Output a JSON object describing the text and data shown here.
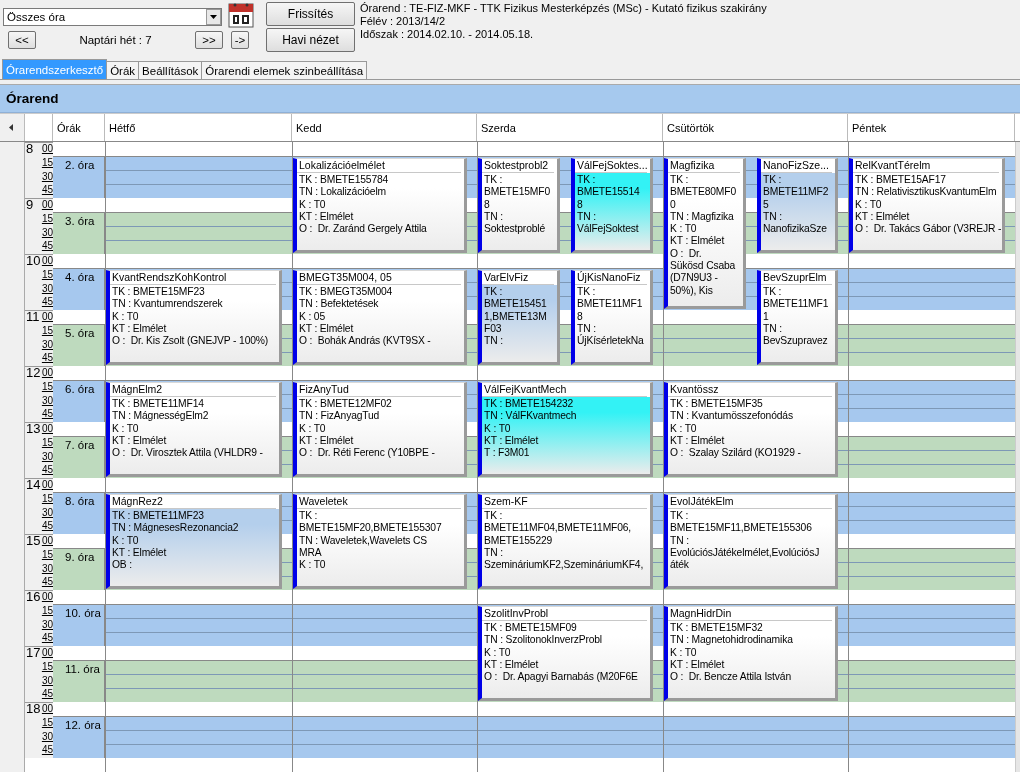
{
  "toolbar": {
    "view_select": {
      "value": "Összes óra"
    },
    "prev_button": "<<",
    "week_label": "Naptári hét : 7",
    "next_button": ">>",
    "go_button": "->",
    "refresh_button": "Frissítés",
    "month_button": "Havi nézet"
  },
  "info": [
    "Órarend : TE-FIZ-MKF - TTK Fizikus Mesterképzés (MSc) - Kutató fizikus szakirány",
    "Félév : 2013/14/2",
    "Időszak : 2014.02.10. - 2014.05.18."
  ],
  "tabs": [
    {
      "label": "Órarendszerkesztő",
      "selected": true
    },
    {
      "label": "Órák",
      "selected": false
    },
    {
      "label": "Beállítások",
      "selected": false
    },
    {
      "label": "Órarendi elemek szinbeállítása",
      "selected": false
    }
  ],
  "panel_title": "Órarend",
  "periods_header": "Órák",
  "days": [
    "Hétfő",
    "Kedd",
    "Szerda",
    "Csütörtök",
    "Péntek"
  ],
  "hours": [
    {
      "hour": "8",
      "minutes": [
        "00",
        "15",
        "30",
        "45"
      ]
    },
    {
      "hour": "9",
      "minutes": [
        "00",
        "15",
        "30",
        "45"
      ]
    },
    {
      "hour": "10",
      "minutes": [
        "00",
        "15",
        "30",
        "45"
      ]
    },
    {
      "hour": "11",
      "minutes": [
        "00",
        "15",
        "30",
        "45"
      ]
    },
    {
      "hour": "12",
      "minutes": [
        "00",
        "15",
        "30",
        "45"
      ]
    },
    {
      "hour": "13",
      "minutes": [
        "00",
        "15",
        "30",
        "45"
      ]
    },
    {
      "hour": "14",
      "minutes": [
        "00",
        "15",
        "30",
        "45"
      ]
    },
    {
      "hour": "15",
      "minutes": [
        "00",
        "15",
        "30",
        "45"
      ]
    },
    {
      "hour": "16",
      "minutes": [
        "00",
        "15",
        "30",
        "45"
      ]
    },
    {
      "hour": "17",
      "minutes": [
        "00",
        "15",
        "30",
        "45"
      ]
    },
    {
      "hour": "18",
      "minutes": [
        "00",
        "15",
        "30",
        "45"
      ]
    }
  ],
  "periods": [
    {
      "label": "2. óra",
      "color": "#a6c8ee",
      "cells": [
        {},
        {
          "events": [
            {
              "kind": "full",
              "title": "Lokalizációelmélet",
              "color": "#ffffff",
              "lines": [
                "TK : BMETE155784",
                "TN : Lokalizációelm",
                "K : T0",
                "KT : Elmélet",
                "O :  Dr. Zaránd Gergely Attila"
              ]
            }
          ]
        },
        {
          "events": [
            {
              "kind": "left",
              "title": "Soktestprobl2",
              "color": "#ffffff",
              "lines": [
                "TK :",
                "BMETE15MF0",
                "8",
                "TN :",
                "Soktestproblé"
              ]
            },
            {
              "kind": "right",
              "title": "VálFejSoktes...",
              "color": "#33f2f5",
              "lines": [
                "TK :",
                "BMETE15514",
                "8",
                "TN :",
                "VálFejSoktest"
              ]
            }
          ]
        },
        {
          "events": [
            {
              "kind": "tallleft",
              "title": "Magfizika",
              "color": "#ffffff",
              "lines": [
                "TK :",
                "BMETE80MF0",
                "0",
                "TN : Magfizika",
                "K : T0",
                "KT : Elmélet",
                "O :  Dr.",
                "Sükösd Csaba",
                "(D7N9U3 -",
                "50%), Kis"
              ]
            },
            {
              "kind": "right",
              "title": "NanoFizSze...",
              "color": "#b4cfec",
              "lines": [
                "TK :",
                "BMETE11MF2",
                "5",
                "TN :",
                "NanofizikaSze"
              ]
            }
          ]
        },
        {
          "events": [
            {
              "kind": "full",
              "title": "RelKvantTérelm",
              "color": "#ffffff",
              "lines": [
                "TK : BMETE15AF17",
                "TN : RelativisztikusKvantumElm",
                "K : T0",
                "KT : Elmélet",
                "O :  Dr. Takács Gábor (V3REJR -"
              ]
            }
          ]
        }
      ]
    },
    {
      "label": "3. óra",
      "color": "#bedabe",
      "cells": [
        {},
        {},
        {},
        {},
        {}
      ]
    },
    {
      "label": "4. óra",
      "color": "#a6c8ee",
      "cells": [
        {
          "events": [
            {
              "kind": "full",
              "title": "KvantRendszKohKontrol",
              "color": "#ffffff",
              "lines": [
                "TK : BMETE15MF23",
                "TN : Kvantumrendszerek",
                "K : T0",
                "KT : Elmélet",
                "O :  Dr. Kis Zsolt (GNEJVP - 100%)"
              ]
            }
          ]
        },
        {
          "events": [
            {
              "kind": "full",
              "title": "BMEGT35M004, 05",
              "color": "#ffffff",
              "lines": [
                "TK : BMEGT35M004",
                "TN : Befektetések",
                "K : 05",
                "KT : Elmélet",
                "O :  Bohák András (KVT9SX -"
              ]
            }
          ]
        },
        {
          "events": [
            {
              "kind": "left",
              "title": "VarElvFiz",
              "color": "#b4cfec",
              "lines": [
                "TK :",
                "BMETE15451",
                "1,BMETE13M",
                "F03",
                "TN :"
              ]
            },
            {
              "kind": "right",
              "title": "ÚjKisNanoFiz",
              "color": "#ffffff",
              "lines": [
                "TK :",
                "BMETE11MF1",
                "8",
                "TN :",
                "ÚjKísérletekNa"
              ]
            }
          ]
        },
        {
          "events": [
            {
              "kind": "right",
              "title": "BevSzuprElm",
              "color": "#ffffff",
              "lines": [
                "TK :",
                "BMETE11MF1",
                "1",
                "TN :",
                "BevSzupravez"
              ]
            }
          ]
        },
        {}
      ]
    },
    {
      "label": "5. óra",
      "color": "#bedabe",
      "cells": [
        {},
        {},
        {},
        {},
        {}
      ]
    },
    {
      "label": "6. óra",
      "color": "#a6c8ee",
      "cells": [
        {
          "events": [
            {
              "kind": "full",
              "title": "MágnElm2",
              "color": "#ffffff",
              "lines": [
                "TK : BMETE11MF14",
                "TN : MágnességElm2",
                "K : T0",
                "KT : Elmélet",
                "O :  Dr. Virosztek Attila (VHLDR9 -"
              ]
            }
          ]
        },
        {
          "events": [
            {
              "kind": "full",
              "title": "FizAnyTud",
              "color": "#ffffff",
              "lines": [
                "TK : BMETE12MF02",
                "TN : FizAnyagTud",
                "K : T0",
                "KT : Elmélet",
                "O :  Dr. Réti Ferenc (Y10BPE -"
              ]
            }
          ]
        },
        {
          "events": [
            {
              "kind": "full",
              "title": "VálFejKvantMech",
              "color": "#33f2f5",
              "lines": [
                "TK : BMETE154232",
                "TN : VálFKvantmech",
                "K : T0",
                "KT : Elmélet",
                "T : F3M01"
              ]
            }
          ]
        },
        {
          "events": [
            {
              "kind": "full",
              "title": "Kvantössz",
              "color": "#ffffff",
              "lines": [
                "TK : BMETE15MF35",
                "TN : Kvantumösszefonódás",
                "K : T0",
                "KT : Elmélet",
                "O :  Szalay Szilárd (KO1929 -"
              ]
            }
          ]
        },
        {}
      ]
    },
    {
      "label": "7. óra",
      "color": "#bedabe",
      "cells": [
        {},
        {},
        {},
        {},
        {}
      ]
    },
    {
      "label": "8. óra",
      "color": "#a6c8ee",
      "cells": [
        {
          "events": [
            {
              "kind": "full",
              "title": "MágnRez2",
              "color": "#b4cfec",
              "lines": [
                "TK : BMETE11MF23",
                "TN : MágnesesRezonancia2",
                "K : T0",
                "KT : Elmélet",
                "OB :"
              ]
            }
          ]
        },
        {
          "events": [
            {
              "kind": "full",
              "title": "Waveletek",
              "color": "#ffffff",
              "lines": [
                "TK :",
                "BMETE15MF20,BMETE155307",
                "TN : Waveletek,Wavelets CS",
                "MRA",
                "K : T0"
              ]
            }
          ]
        },
        {
          "events": [
            {
              "kind": "full",
              "title": "Szem-KF",
              "color": "#ffffff",
              "lines": [
                "TK :",
                "BMETE11MF04,BMETE11MF06,",
                "BMETE155229",
                "TN :",
                "SzemináriumKF2,SzemináriumKF4,"
              ]
            }
          ]
        },
        {
          "events": [
            {
              "kind": "full",
              "title": "EvolJátékElm",
              "color": "#ffffff",
              "lines": [
                "TK :",
                "BMETE15MF11,BMETE155306",
                "TN :",
                "EvolúciósJátékelmélet,EvolúciósJ",
                "áték"
              ]
            }
          ]
        },
        {}
      ]
    },
    {
      "label": "9. óra",
      "color": "#bedabe",
      "cells": [
        {},
        {},
        {},
        {},
        {}
      ]
    },
    {
      "label": "10. óra",
      "color": "#a6c8ee",
      "cells": [
        {},
        {},
        {
          "events": [
            {
              "kind": "full",
              "title": "SzolitInvProbl",
              "color": "#ffffff",
              "lines": [
                "TK : BMETE15MF09",
                "TN : SzolitonokInverzProbl",
                "K : T0",
                "KT : Elmélet",
                "O :  Dr. Apagyi Barnabás (M20F6E"
              ]
            }
          ]
        },
        {
          "events": [
            {
              "kind": "full",
              "title": "MagnHidrDin",
              "color": "#ffffff",
              "lines": [
                "TK : BMETE15MF32",
                "TN : Magnetohidrodinamika",
                "K : T0",
                "KT : Elmélet",
                "O :  Dr. Bencze Attila István"
              ]
            }
          ]
        },
        {}
      ]
    },
    {
      "label": "11. óra",
      "color": "#bedabe",
      "cells": [
        {},
        {},
        {},
        {},
        {}
      ]
    },
    {
      "label": "12. óra",
      "color": "#a6c8ee",
      "cells": [
        {},
        {},
        {},
        {},
        {}
      ]
    }
  ]
}
